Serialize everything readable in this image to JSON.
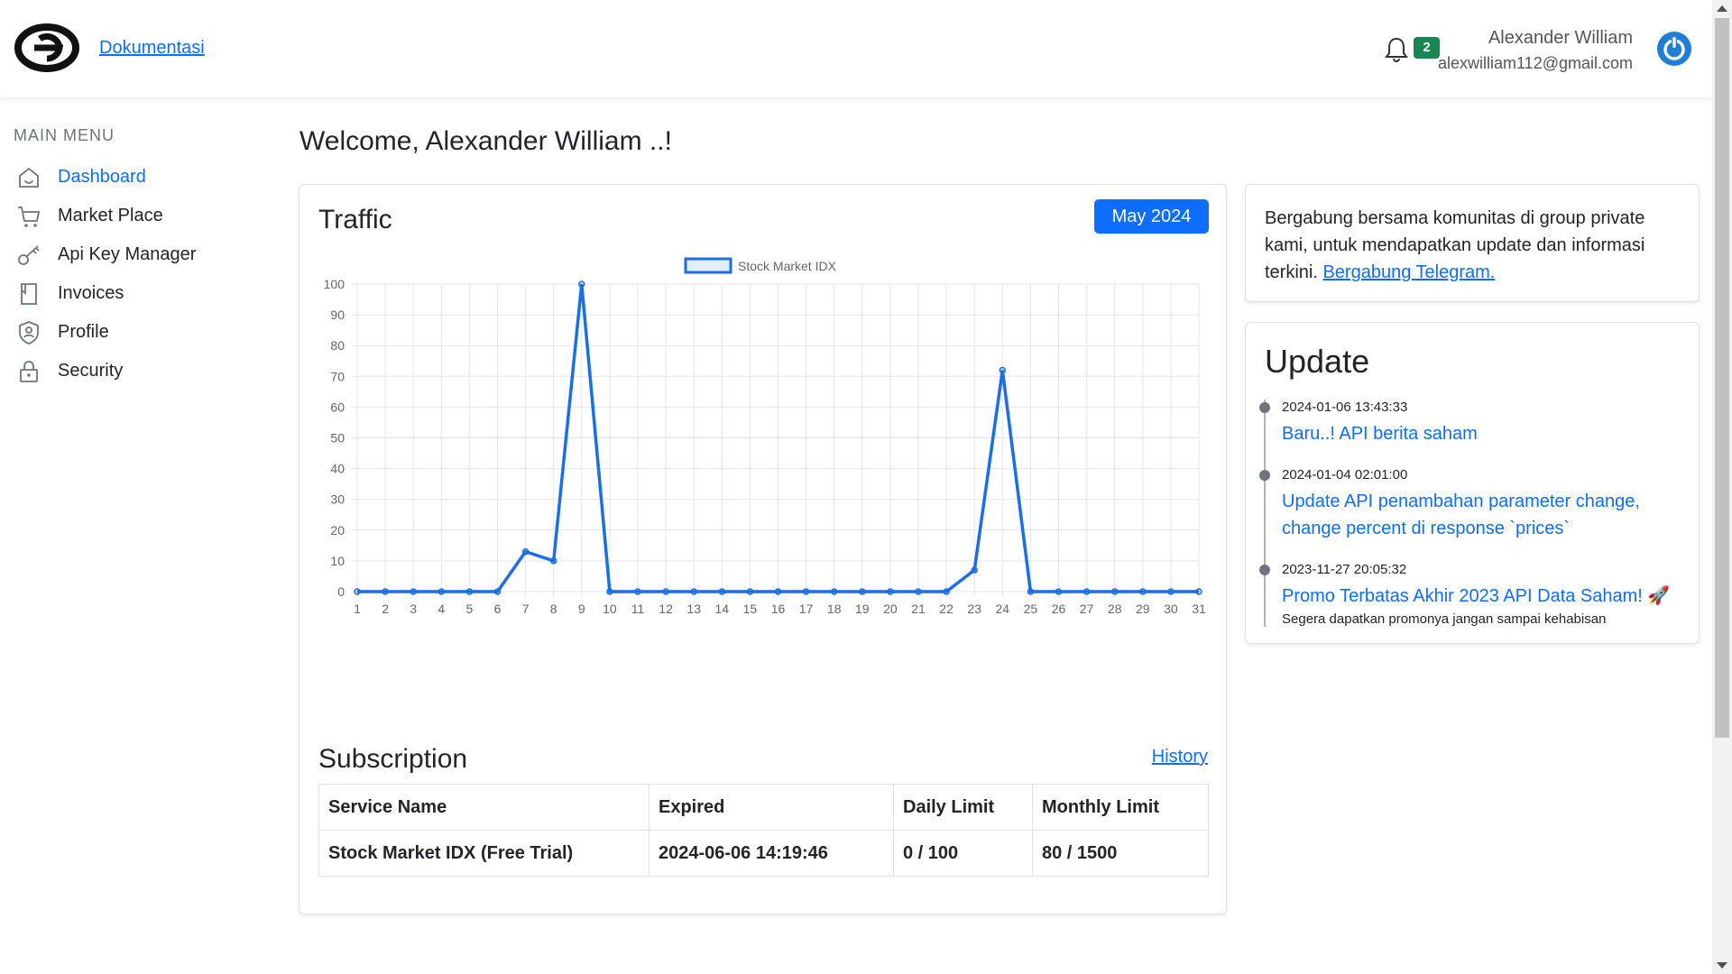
{
  "header": {
    "doc_link": "Dokumentasi",
    "notification_count": "2",
    "user_name": "Alexander William",
    "user_email": "alexwilliam112@gmail.com"
  },
  "sidebar": {
    "title": "MAIN MENU",
    "items": [
      {
        "label": "Dashboard",
        "icon": "home-icon",
        "active": true
      },
      {
        "label": "Market Place",
        "icon": "cart-icon",
        "active": false
      },
      {
        "label": "Api Key Manager",
        "icon": "key-icon",
        "active": false
      },
      {
        "label": "Invoices",
        "icon": "invoice-icon",
        "active": false
      },
      {
        "label": "Profile",
        "icon": "profile-shield-icon",
        "active": false
      },
      {
        "label": "Security",
        "icon": "lock-icon",
        "active": false
      }
    ]
  },
  "main": {
    "welcome": "Welcome, Alexander William ..!",
    "traffic_title": "Traffic",
    "month_button": "May 2024",
    "subscription_title": "Subscription",
    "history_link": "History",
    "table": {
      "headers": [
        "Service Name",
        "Expired",
        "Daily Limit",
        "Monthly Limit"
      ],
      "rows": [
        [
          "Stock Market IDX (Free Trial)",
          "2024-06-06 14:19:46",
          "0 / 100",
          "80 / 1500"
        ]
      ]
    }
  },
  "telegram": {
    "text": "Bergabung bersama komunitas di group private kami, untuk mendapatkan update dan informasi terkini.",
    "link": "Bergabung Telegram."
  },
  "updates": {
    "title": "Update",
    "items": [
      {
        "date": "2024-01-06 13:43:33",
        "title": "Baru..! API berita saham",
        "desc": ""
      },
      {
        "date": "2024-01-04 02:01:00",
        "title": "Update API penambahan parameter change, change percent di response `prices`",
        "desc": ""
      },
      {
        "date": "2023-11-27 20:05:32",
        "title": "Promo Terbatas Akhir 2023 API Data Saham! 🚀",
        "desc": "Segera dapatkan promonya jangan sampai kehabisan"
      }
    ]
  },
  "colors": {
    "accent": "#0d6efd",
    "line": "#1a6ee6",
    "badge": "#198754"
  },
  "chart_data": {
    "type": "line",
    "x": [
      1,
      2,
      3,
      4,
      5,
      6,
      7,
      8,
      9,
      10,
      11,
      12,
      13,
      14,
      15,
      16,
      17,
      18,
      19,
      20,
      21,
      22,
      23,
      24,
      25,
      26,
      27,
      28,
      29,
      30,
      31
    ],
    "series": [
      {
        "name": "Stock Market IDX",
        "values": [
          0,
          0,
          0,
          0,
          0,
          0,
          13,
          10,
          100,
          0,
          0,
          0,
          0,
          0,
          0,
          0,
          0,
          0,
          0,
          0,
          0,
          0,
          7,
          72,
          0,
          0,
          0,
          0,
          0,
          0,
          0
        ]
      }
    ],
    "ylim": [
      0,
      100
    ],
    "yticks": [
      0,
      10,
      20,
      30,
      40,
      50,
      60,
      70,
      80,
      90,
      100
    ],
    "grid": true,
    "legend": "top-center"
  }
}
